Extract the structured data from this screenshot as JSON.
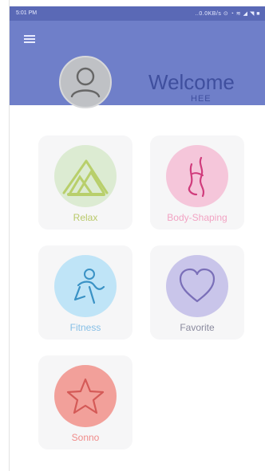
{
  "statusbar": {
    "time": "5:01 PM",
    "right": "..0.0KB/s ⊙ ◔ ≋ ◢ ◥ ■"
  },
  "header": {
    "title": "Welcome",
    "username": "HEE"
  },
  "icons": {
    "menu": "menu-icon",
    "avatar": "user-icon"
  },
  "categories": [
    {
      "label": "Relax",
      "icon": "grass-icon",
      "circle_color": "#dcebd2",
      "text_color": "#b9c96a"
    },
    {
      "label": "Body-Shaping",
      "icon": "body-torso-icon",
      "circle_color": "#f5c6da",
      "text_color": "#f2a3c3"
    },
    {
      "label": "Fitness",
      "icon": "fitness-runner-icon",
      "circle_color": "#bfe4f7",
      "text_color": "#86bfe6"
    },
    {
      "label": "Favorite",
      "icon": "heart-icon",
      "circle_color": "#c9c5ea",
      "text_color": "#8a8a9e"
    },
    {
      "label": "Sonno",
      "icon": "star-icon",
      "circle_color": "#f2a09a",
      "text_color": "#f08c8a"
    }
  ]
}
